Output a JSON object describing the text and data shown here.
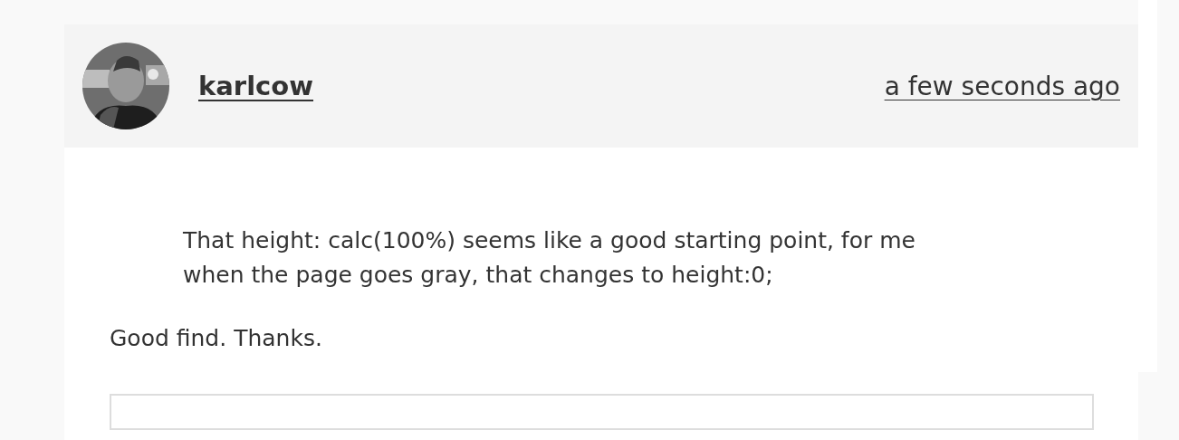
{
  "comment": {
    "author": "karlcow",
    "time": "a few seconds ago",
    "quote": "That height: calc(100%) seems like a good starting point, for me when the page goes gray, that changes to height:0;",
    "text": "Good find. Thanks."
  }
}
